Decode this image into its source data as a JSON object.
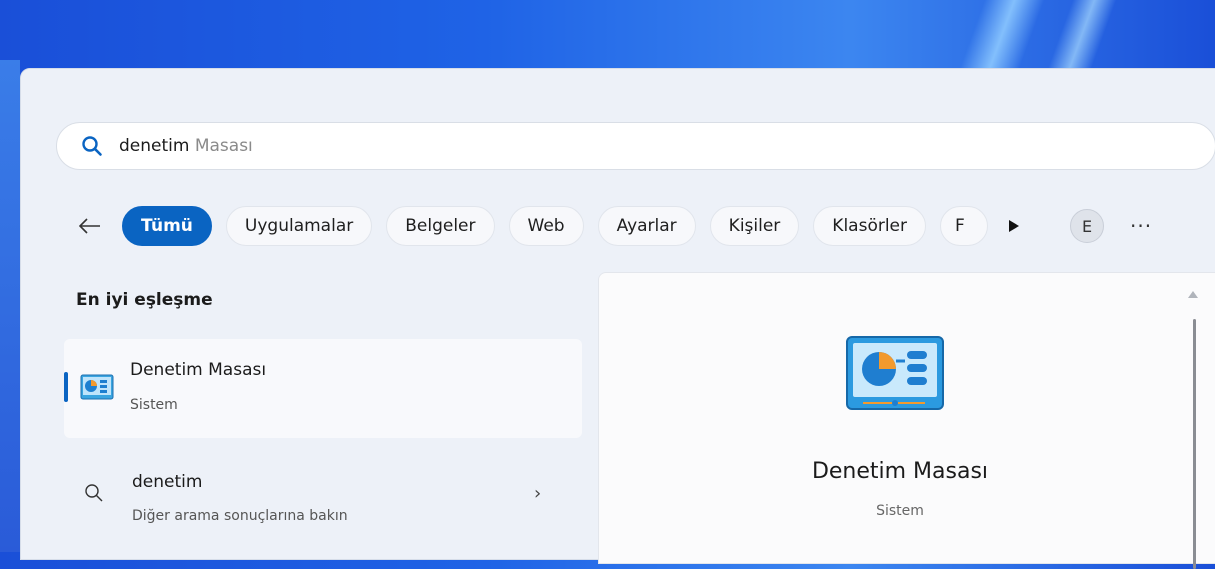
{
  "search": {
    "typed": "denetim",
    "suggestion": " Masası"
  },
  "filters": {
    "chips": [
      "Tümü",
      "Uygulamalar",
      "Belgeler",
      "Web",
      "Ayarlar",
      "Kişiler",
      "Klasörler",
      "F"
    ],
    "avatar_letter": "E",
    "more": "···"
  },
  "best_match": {
    "section_title": "En iyi eşleşme",
    "title": "Denetim Masası",
    "subtitle": "Sistem"
  },
  "web_search": {
    "title": "denetim",
    "subtitle": "Diğer arama sonuçlarına bakın",
    "chevron": "›"
  },
  "detail": {
    "title": "Denetim Masası",
    "subtitle": "Sistem"
  },
  "colors": {
    "accent": "#0a64c2",
    "panel": "#edf1f8"
  }
}
